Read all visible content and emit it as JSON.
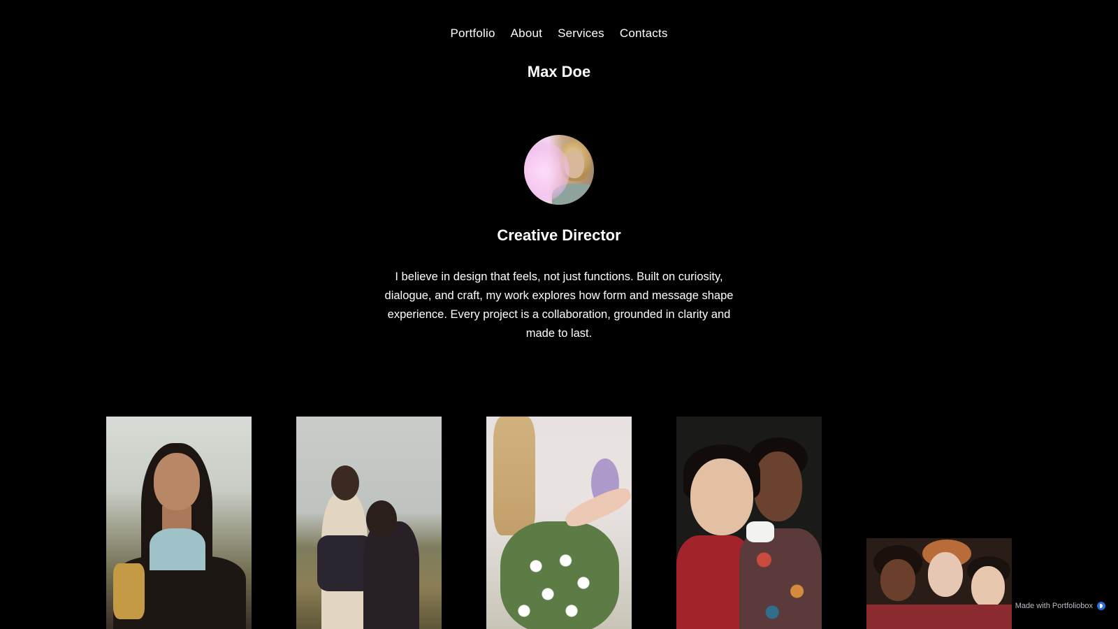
{
  "nav": {
    "items": [
      "Portfolio",
      "About",
      "Services",
      "Contacts"
    ]
  },
  "site_title": "Max Doe",
  "profile": {
    "avatar_icon": "portrait-avatar",
    "role": "Creative Director",
    "bio": "I believe in design that feels, not just functions. Built on curiosity, dialogue, and craft, my work explores how form and message shape experience. Every project is a collaboration, grounded in clarity and made to last."
  },
  "gallery": {
    "items": [
      {
        "subject": "woman-braids-field"
      },
      {
        "subject": "couple-in-field"
      },
      {
        "subject": "hand-picking-daisies"
      },
      {
        "subject": "two-women-embrace-shawl"
      },
      {
        "subject": "three-women-portrait"
      }
    ]
  },
  "footer_badge": {
    "text": "Made with Portfoliobox",
    "icon": "portfoliobox-logo-icon",
    "accent_color": "#2f6bd8"
  },
  "colors": {
    "background": "#000000",
    "text": "#ffffff"
  }
}
